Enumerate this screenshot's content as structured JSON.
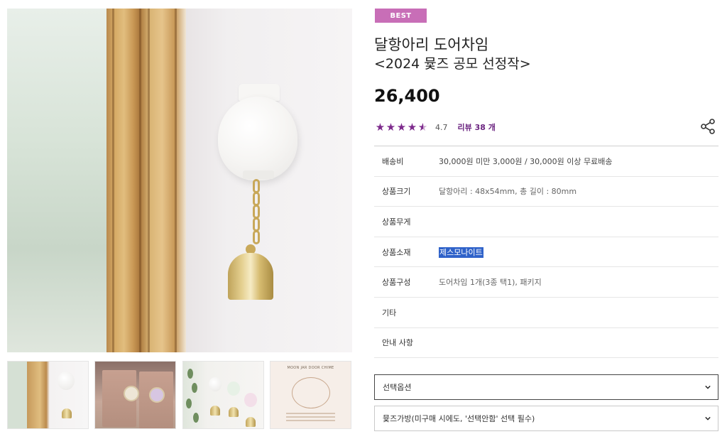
{
  "product": {
    "badge": "BEST",
    "title": "달항아리 도어차임",
    "subtitle": "<2024 뮻즈 공모 선정작>",
    "price": "26,400",
    "rating_score": "4.7",
    "rating_value": 4.7,
    "review_label": "리뷰 38 개"
  },
  "specs": [
    {
      "label": "배송비",
      "value": "30,000원 미만 3,000원 / 30,000원 이상 무료배송"
    },
    {
      "label": "상품크기",
      "value": "달항아리 : 48x54mm, 총 길이 : 80mm"
    },
    {
      "label": "상품무게",
      "value": ""
    },
    {
      "label": "상품소재",
      "value": "제스모나이트"
    },
    {
      "label": "상품구성",
      "value": "도어차임 1개(3종 택1), 패키지"
    },
    {
      "label": "기타",
      "value": ""
    },
    {
      "label": "안내 사항",
      "value": ""
    }
  ],
  "options": {
    "select_option": "선택옵션",
    "bag_option": "뮻즈가방(미구매 시에도, '선택안함' 선택 필수)"
  },
  "gallery": {
    "card_title": "MOON JAR DOOR CHIME"
  },
  "colors": {
    "badge": "#c86eb7",
    "star": "#7d2a8c",
    "review_link": "#6b2480",
    "text_highlight": "#2f62c9"
  },
  "icons": {
    "share": "share-icon",
    "chevron": "chevron-down-icon",
    "star": "star-icon"
  }
}
